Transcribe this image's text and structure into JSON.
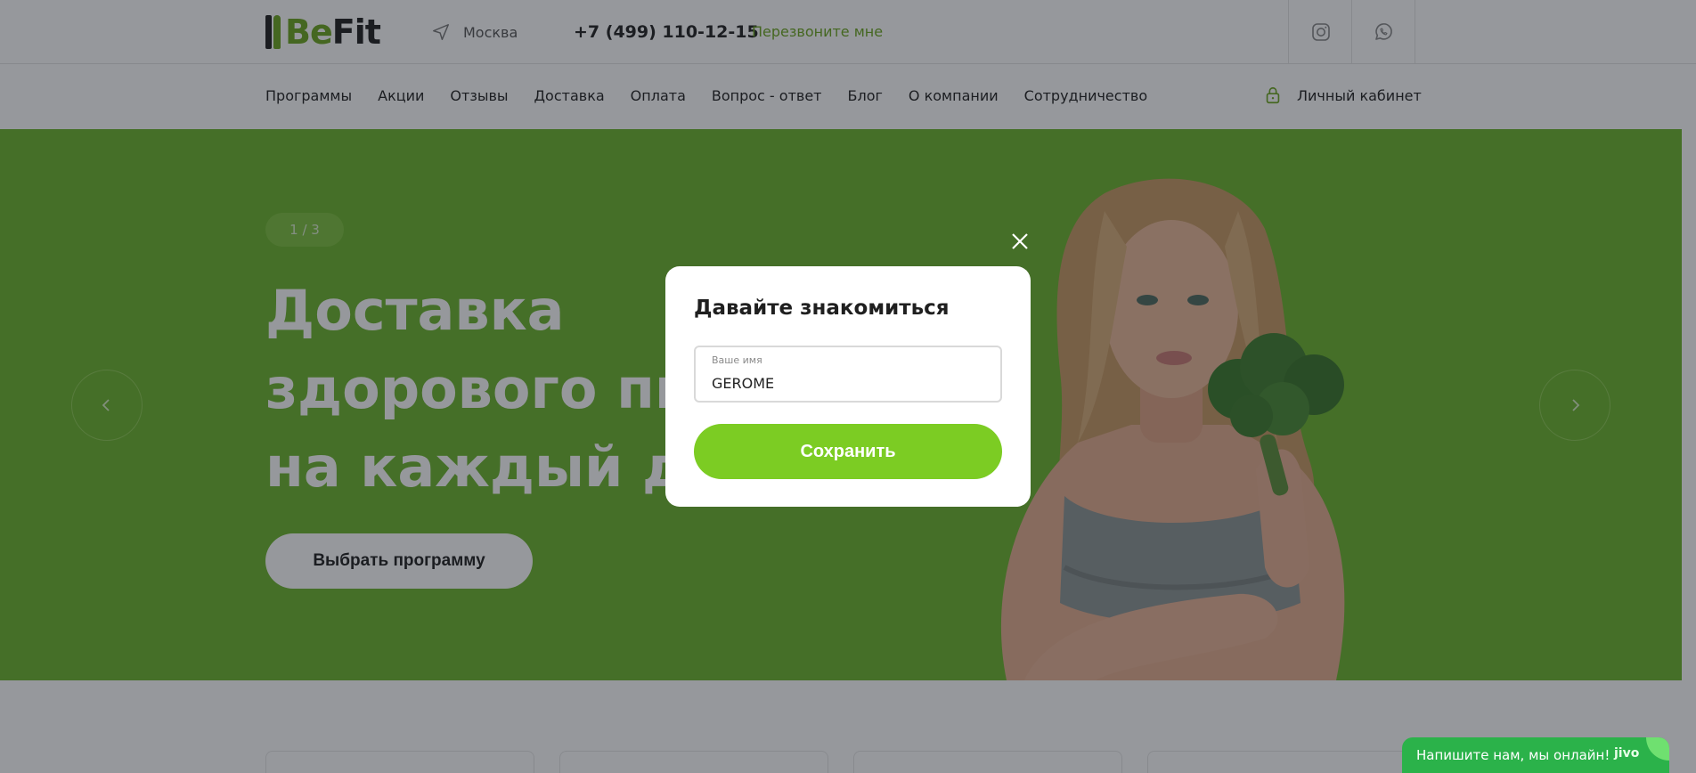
{
  "header": {
    "logo_be": "Be",
    "logo_fit": "Fit",
    "city": "Москва",
    "phone": "+7 (499) 110-12-15",
    "callback_label": "Перезвоните мне",
    "social_icons": [
      "instagram-icon",
      "whatsapp-icon"
    ]
  },
  "nav": {
    "items": [
      {
        "label": "Программы"
      },
      {
        "label": "Акции"
      },
      {
        "label": "Отзывы"
      },
      {
        "label": "Доставка"
      },
      {
        "label": "Оплата"
      },
      {
        "label": "Вопрос - ответ"
      },
      {
        "label": "Блог"
      },
      {
        "label": "О компании"
      },
      {
        "label": "Сотрудничество"
      }
    ],
    "cabinet_label": "Личный кабинет"
  },
  "hero": {
    "slide_counter": "1 / 3",
    "title_lines": [
      "Доставка",
      "здорового питания",
      "на каждый день"
    ],
    "cta_label": "Выбрать программу",
    "bg_color": "#6cb52c"
  },
  "modal": {
    "title": "Давайте знакомиться",
    "name_field": {
      "label": "Ваше имя",
      "value": "GEROME"
    },
    "save_label": "Сохранить",
    "accent_color": "#7ccc23"
  },
  "chat": {
    "text": "Напишите нам, мы онлайн!",
    "brand": "jivo"
  }
}
